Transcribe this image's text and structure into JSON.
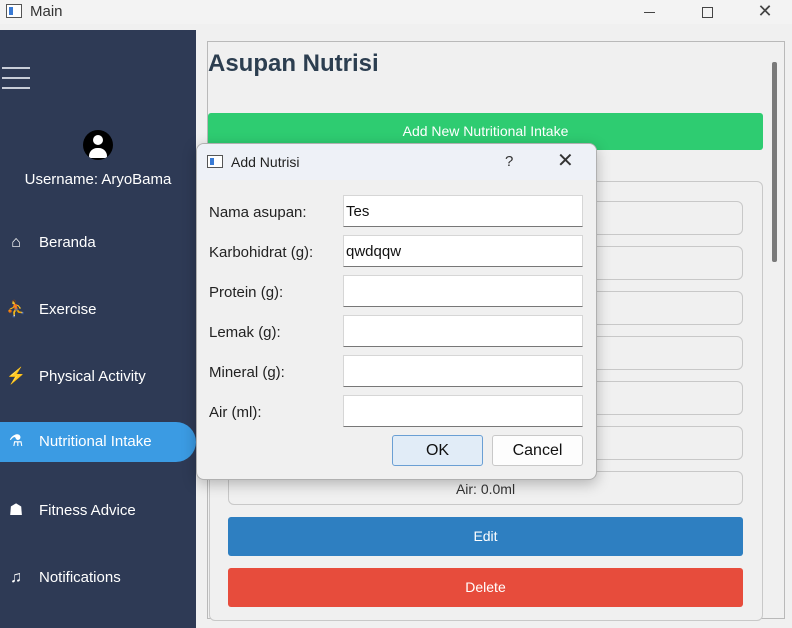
{
  "window": {
    "title": "Main",
    "icon": "window-app-icon",
    "controls": [
      "minimize-icon",
      "maximize-icon",
      "close-icon"
    ]
  },
  "sidebar": {
    "menu_icon": "hamburger-icon",
    "avatar_icon": "user-circle-icon",
    "username": "Username: AryoBama",
    "items": [
      {
        "label": "Beranda",
        "icon": "home-icon",
        "glyph": "⌂"
      },
      {
        "label": "Exercise",
        "icon": "exercise-icon",
        "glyph": "⛹"
      },
      {
        "label": "Physical Activity",
        "icon": "running-icon",
        "glyph": "⚡"
      },
      {
        "label": "Nutritional Intake",
        "icon": "nutrition-icon",
        "glyph": "⚗"
      },
      {
        "label": "Fitness Advice",
        "icon": "trainer-icon",
        "glyph": "☗"
      },
      {
        "label": "Notifications",
        "icon": "bell-icon",
        "glyph": "♫"
      }
    ],
    "active_item": "Nutritional Intake"
  },
  "main": {
    "title": "Asupan Nutrisi",
    "add_button": "Add New Nutritional Intake",
    "card": {
      "visible_field": "Air: 0.0ml",
      "edit_button": "Edit",
      "delete_button": "Delete"
    }
  },
  "dialog": {
    "title": "Add Nutrisi",
    "help": "?",
    "close": "✕",
    "fields": [
      {
        "label": "Nama asupan:",
        "value": "Tes"
      },
      {
        "label": "Karbohidrat (g):",
        "value": "qwdqqw"
      },
      {
        "label": "Protein (g):",
        "value": ""
      },
      {
        "label": "Lemak (g):",
        "value": ""
      },
      {
        "label": "Mineral (g):",
        "value": ""
      },
      {
        "label": "Air (ml):",
        "value": ""
      }
    ],
    "ok_button": "OK",
    "cancel_button": "Cancel"
  },
  "colors": {
    "sidebar_bg": "#2e3a55",
    "active_item": "#3b9be3",
    "add_button": "#2ecc71",
    "edit_button": "#2e7fc1",
    "delete_button": "#e74c3c",
    "title_text": "#2c3e50"
  }
}
